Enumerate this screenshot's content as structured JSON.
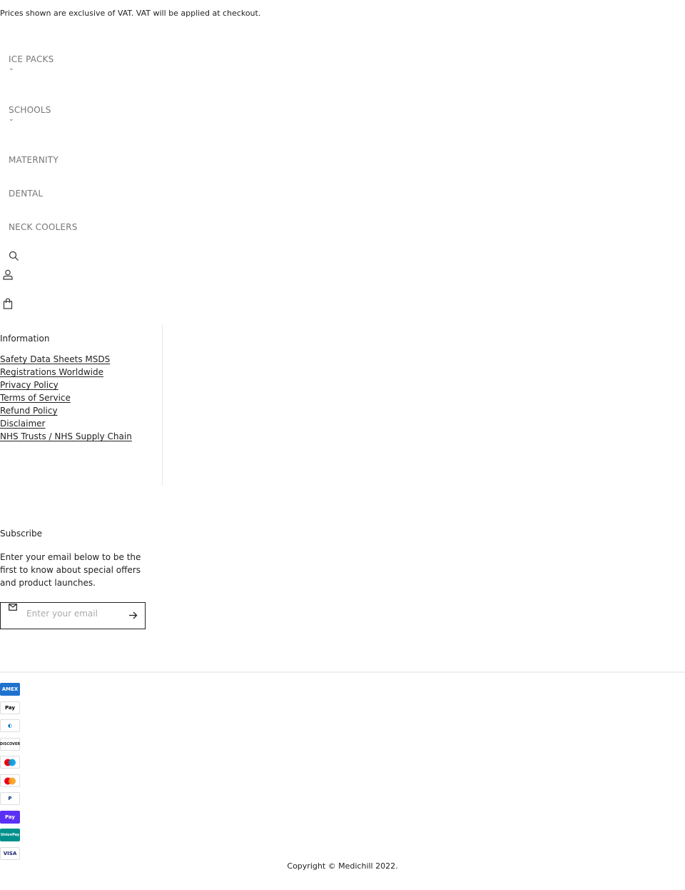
{
  "announcement": "Prices shown are exclusive of VAT. VAT will be applied at checkout.",
  "nav": {
    "items": [
      {
        "label": "ICE PACKS",
        "has_dropdown": true
      },
      {
        "label": "SCHOOLS",
        "has_dropdown": true
      },
      {
        "label": "MATERNITY",
        "has_dropdown": false
      },
      {
        "label": "DENTAL",
        "has_dropdown": false
      },
      {
        "label": "NECK COOLERS",
        "has_dropdown": false
      }
    ],
    "chevron_glyph": "⌄",
    "icons": [
      "search-icon",
      "account-icon",
      "cart-icon"
    ]
  },
  "footer": {
    "information": {
      "title": "Information",
      "links": [
        "Safety Data Sheets MSDS",
        "Registrations Worldwide",
        "Privacy Policy",
        "Terms of Service",
        "Refund Policy",
        "Disclaimer",
        "NHS Trusts / NHS Supply Chain"
      ]
    },
    "subscribe": {
      "title": "Subscribe",
      "text": "Enter your email below to be the first to know about special offers and product launches.",
      "placeholder": "Enter your email",
      "value": ""
    },
    "payments": [
      {
        "name": "American Express",
        "label": "AMEX",
        "bg": "#1f72cd",
        "fg": "#ffffff"
      },
      {
        "name": "Apple Pay",
        "label": "Pay",
        "bg": "#ffffff",
        "fg": "#000000"
      },
      {
        "name": "Diners Club",
        "label": "◐",
        "bg": "#ffffff",
        "fg": "#0079be"
      },
      {
        "name": "Discover",
        "label": "DISCOVER",
        "bg": "#ffffff",
        "fg": "#222222"
      },
      {
        "name": "Maestro",
        "label": "",
        "bg": "#ffffff",
        "fg": "#000000"
      },
      {
        "name": "Mastercard",
        "label": "",
        "bg": "#ffffff",
        "fg": "#000000"
      },
      {
        "name": "PayPal",
        "label": "P",
        "bg": "#ffffff",
        "fg": "#003087"
      },
      {
        "name": "Shop Pay",
        "label": "Pay",
        "bg": "#5a31f4",
        "fg": "#ffffff"
      },
      {
        "name": "Union Pay",
        "label": "UnionPay",
        "bg": "#00908c",
        "fg": "#ffffff"
      },
      {
        "name": "Visa",
        "label": "VISA",
        "bg": "#ffffff",
        "fg": "#1a1f71"
      }
    ],
    "copyright": "Copyright © Medichill 2022."
  }
}
